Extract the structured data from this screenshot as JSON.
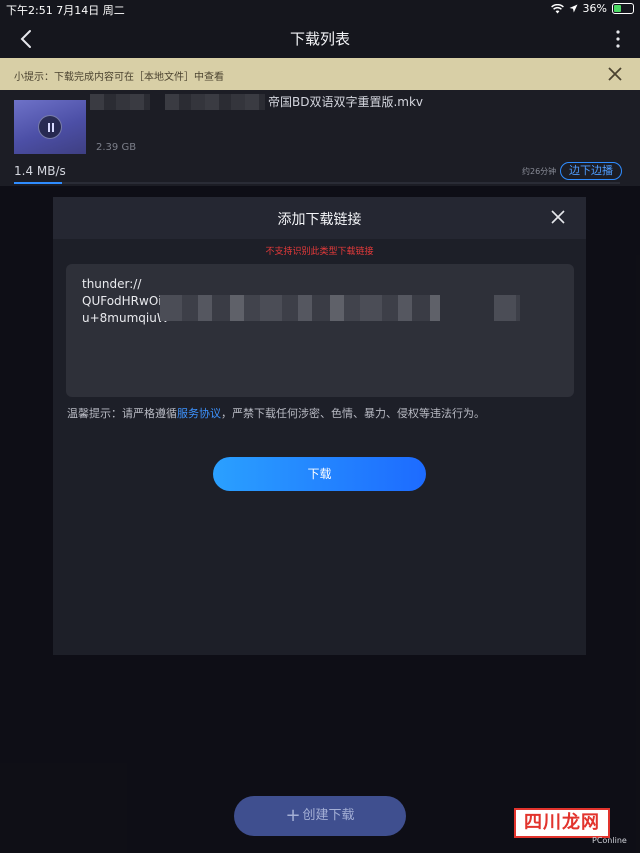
{
  "status_bar": {
    "time_date": "下午2:51   7月14日 周二",
    "battery": "36%"
  },
  "header": {
    "title": "下载列表"
  },
  "tip": {
    "text": "小提示：下载完成内容可在［本地文件］中查看"
  },
  "download_item": {
    "filename_visible": "帝国BD双语双字重置版.mkv",
    "size": "2.39 GB",
    "speed": "1.4 MB/s",
    "eta": "约26分钟",
    "play_label": "边下边播",
    "progress": 0.08
  },
  "modal": {
    "title": "添加下载链接",
    "error": "不支持识别此类型下载链接",
    "link_text": "thunder://\nQUFodHRwOi\nu+8mumqiuW",
    "notice_before": "温馨提示：请严格遵循",
    "notice_link": "服务协议",
    "notice_after": "，严禁下载任何涉密、色情、暴力、侵权等违法行为。",
    "download_label": "下载"
  },
  "bottom": {
    "create_label": "创建下载"
  },
  "watermark": {
    "text": "四川龙网",
    "sub": "PConline"
  },
  "colors": {
    "accent": "#2f8cff",
    "error": "#e53a3a",
    "tip_bg": "#d8cfa6"
  }
}
